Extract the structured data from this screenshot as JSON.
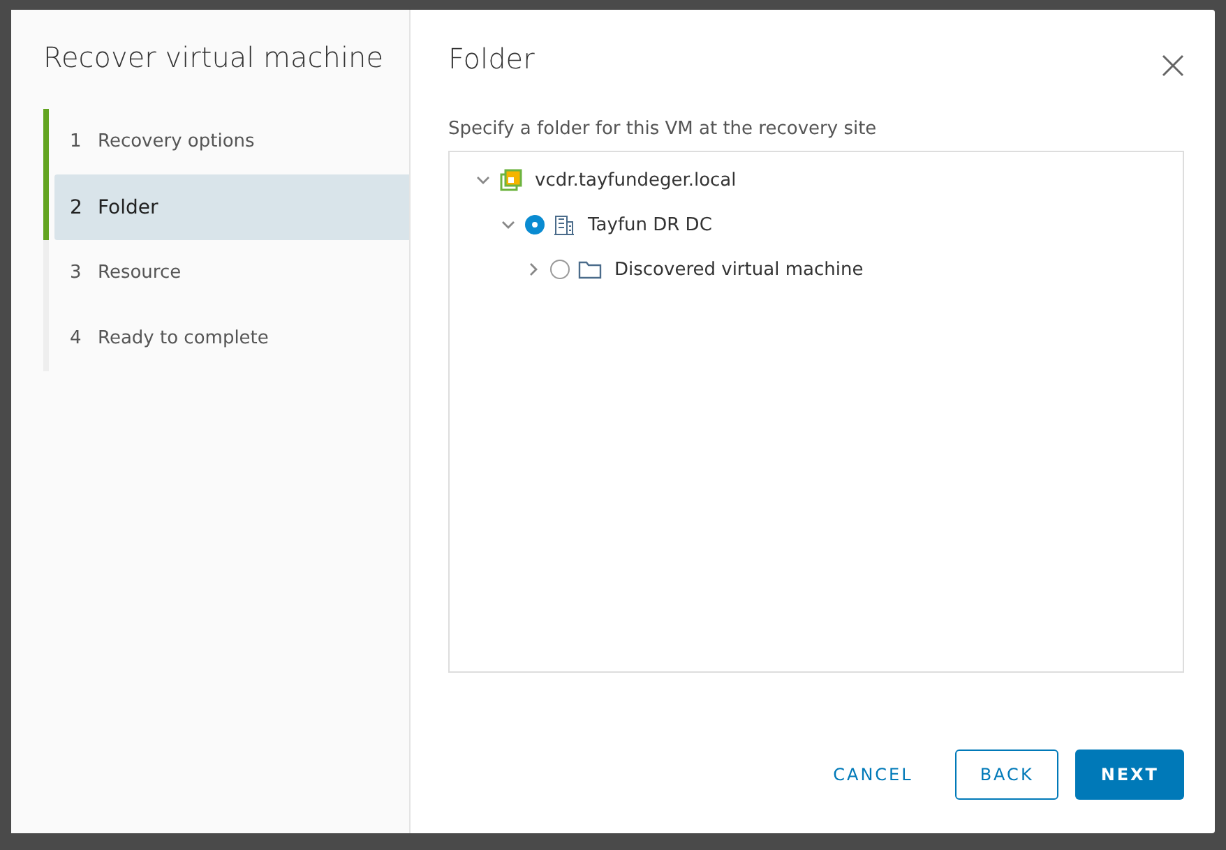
{
  "wizard": {
    "title": "Recover virtual machine",
    "steps": [
      {
        "number": "1",
        "label": "Recovery options",
        "selected": false
      },
      {
        "number": "2",
        "label": "Folder",
        "selected": true
      },
      {
        "number": "3",
        "label": "Resource",
        "selected": false
      },
      {
        "number": "4",
        "label": "Ready to complete",
        "selected": false
      }
    ]
  },
  "page": {
    "title": "Folder",
    "description": "Specify a folder for this VM at the recovery site",
    "tree": [
      {
        "label": "vcdr.tayfundeger.local",
        "kind": "vcenter",
        "expanded": true,
        "children": [
          {
            "label": "Tayfun DR DC",
            "kind": "datacenter",
            "expanded": true,
            "selected": true,
            "children": [
              {
                "label": "Discovered virtual machine",
                "kind": "folder",
                "expanded": false,
                "selected": false
              }
            ]
          }
        ]
      }
    ]
  },
  "buttons": [
    {
      "label": "CANCEL",
      "kind": "flat"
    },
    {
      "label": "BACK",
      "kind": "outline"
    },
    {
      "label": "NEXT",
      "kind": "primary"
    }
  ]
}
